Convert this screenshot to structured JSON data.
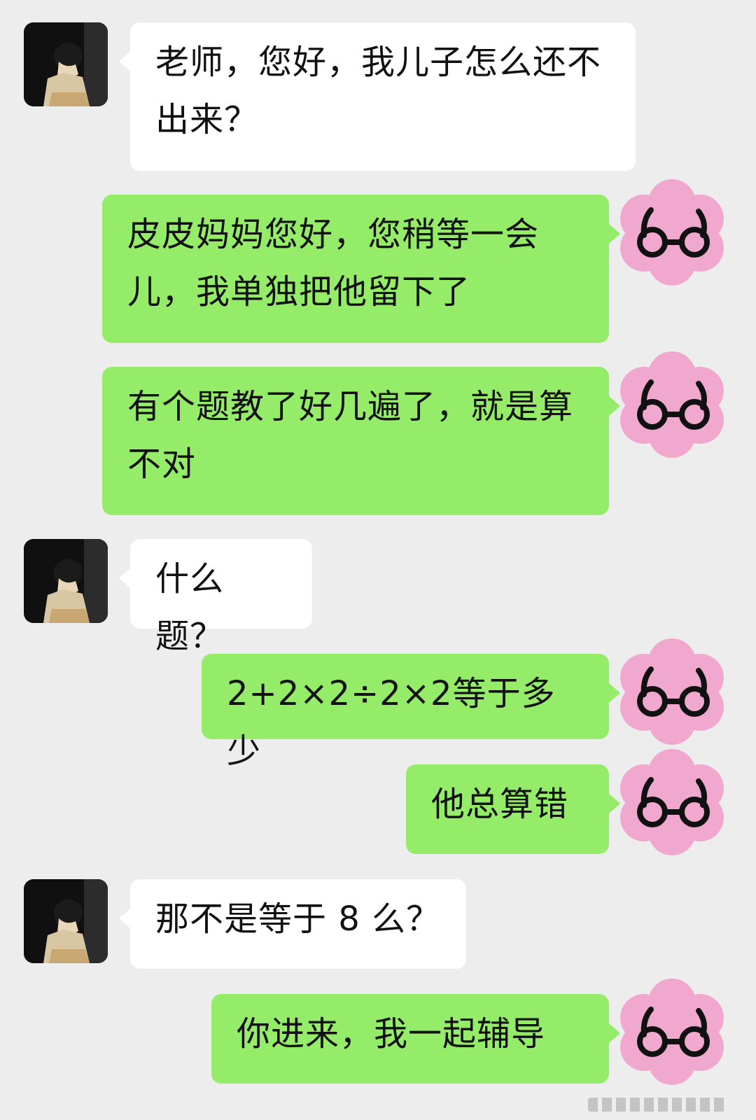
{
  "messages": [
    {
      "sender": "teacher",
      "text": "老师，您好，我儿子怎么还不出来？"
    },
    {
      "sender": "parent",
      "text": "皮皮妈妈您好，您稍等一会儿，我单独把他留下了"
    },
    {
      "sender": "parent",
      "text": "有个题教了好几遍了，就是算不对"
    },
    {
      "sender": "teacher",
      "text": "什么题？"
    },
    {
      "sender": "parent",
      "text": "2+2×2÷2×2等于多少"
    },
    {
      "sender": "parent",
      "text": "他总算错"
    },
    {
      "sender": "teacher",
      "text": "那不是等于 8 么？"
    },
    {
      "sender": "parent",
      "text": "你进来，我一起辅导"
    }
  ],
  "colors": {
    "background": "#ededed",
    "incoming_bubble": "#ffffff",
    "outgoing_bubble": "#95ec69",
    "outgoing_avatar": "#f1a8cf"
  },
  "icons": {
    "incoming_avatar": "person-reading-photo",
    "outgoing_avatar": "pink-flower-glasses-icon"
  }
}
